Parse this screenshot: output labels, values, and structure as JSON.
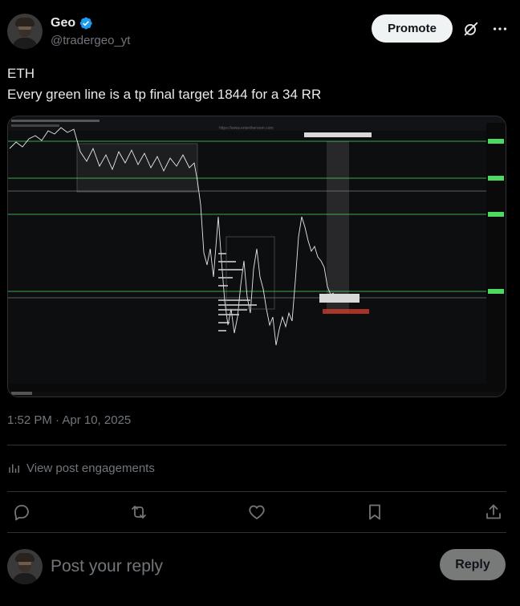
{
  "author": {
    "display_name": "Geo",
    "handle": "@tradergeo_yt",
    "verified": true
  },
  "header": {
    "promote_label": "Promote",
    "grok_icon": "grok-icon",
    "more_icon": "more-horizontal-icon"
  },
  "tweet": {
    "line1": "ETH",
    "line2": "Every green line is a tp final target 1844 for a 34 RR"
  },
  "media": {
    "watermark": "https://www.entertheroom.com",
    "brand": "TradingView"
  },
  "meta": {
    "timestamp": "1:52 PM · Apr 10, 2025"
  },
  "engagements": {
    "label": "View post engagements",
    "icon": "analytics-icon"
  },
  "actions": [
    {
      "name": "reply-icon"
    },
    {
      "name": "repost-icon"
    },
    {
      "name": "like-icon"
    },
    {
      "name": "bookmark-icon"
    },
    {
      "name": "share-icon"
    }
  ],
  "reply_box": {
    "placeholder": "Post your reply",
    "button_label": "Reply"
  },
  "colors": {
    "background": "#000000",
    "text_primary": "#e7e9ea",
    "text_secondary": "#71767b",
    "border": "#2f3336",
    "verified_blue": "#1d9bf0",
    "tp_green": "#4cd964"
  }
}
